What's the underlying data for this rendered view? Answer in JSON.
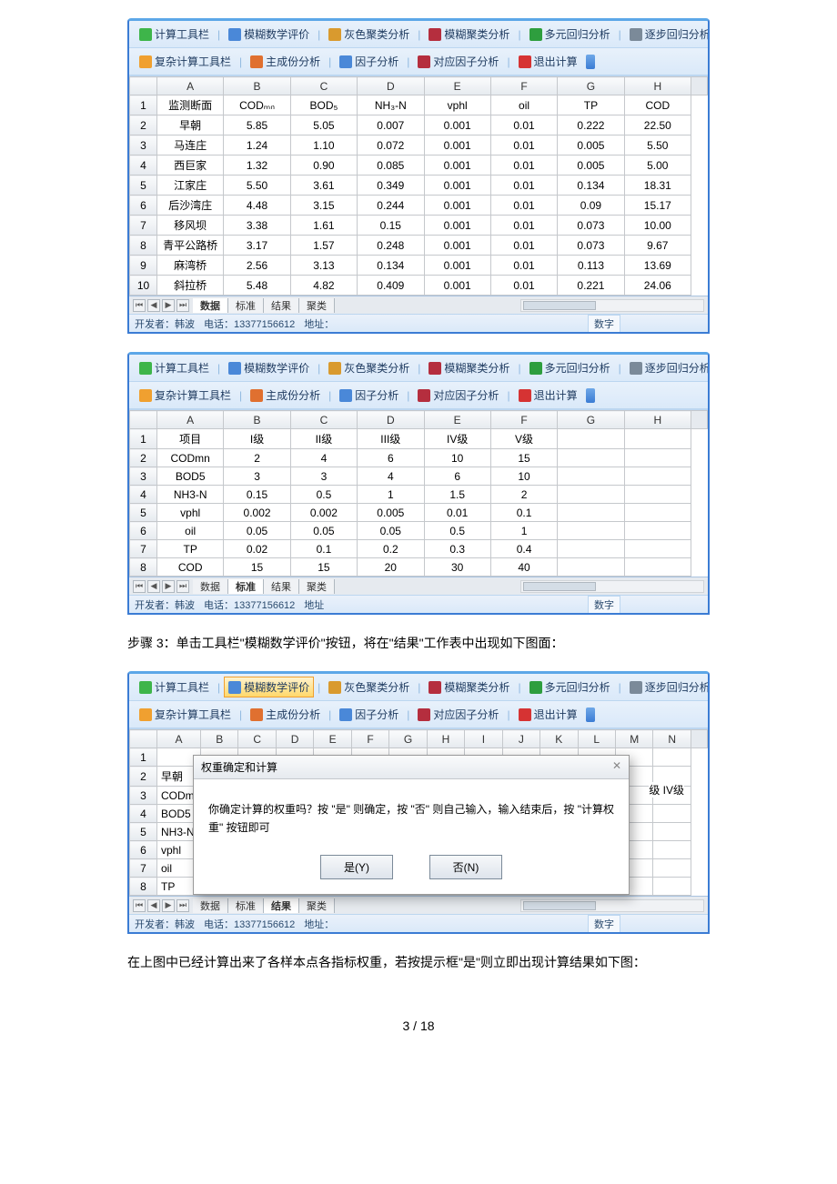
{
  "toolbar1": {
    "calc": "计算工具栏",
    "fuzzy": "模糊数学评价",
    "gray": "灰色聚类分析",
    "cluster": "模糊聚类分析",
    "regr": "多元回归分析",
    "step": "逐步回归分析"
  },
  "toolbar2": {
    "complex": "复杂计算工具栏",
    "pca": "主成份分析",
    "factor": "因子分析",
    "corr": "对应因子分析",
    "exit": "退出计算"
  },
  "cols8": [
    "A",
    "B",
    "C",
    "D",
    "E",
    "F",
    "G",
    "H"
  ],
  "cols14": [
    "A",
    "B",
    "C",
    "D",
    "E",
    "F",
    "G",
    "H",
    "I",
    "J",
    "K",
    "L",
    "M",
    "N"
  ],
  "table1": {
    "rows": [
      {
        "n": "1",
        "a": "监测断面",
        "b": "CODₘₙ",
        "c": "BOD₅",
        "d": "NH₃-N",
        "e": "vphl",
        "f": "oil",
        "g": "TP",
        "h": "COD"
      },
      {
        "n": "2",
        "a": "早朝",
        "b": "5.85",
        "c": "5.05",
        "d": "0.007",
        "e": "0.001",
        "f": "0.01",
        "g": "0.222",
        "h": "22.50"
      },
      {
        "n": "3",
        "a": "马连庄",
        "b": "1.24",
        "c": "1.10",
        "d": "0.072",
        "e": "0.001",
        "f": "0.01",
        "g": "0.005",
        "h": "5.50"
      },
      {
        "n": "4",
        "a": "西巨家",
        "b": "1.32",
        "c": "0.90",
        "d": "0.085",
        "e": "0.001",
        "f": "0.01",
        "g": "0.005",
        "h": "5.00"
      },
      {
        "n": "5",
        "a": "江家庄",
        "b": "5.50",
        "c": "3.61",
        "d": "0.349",
        "e": "0.001",
        "f": "0.01",
        "g": "0.134",
        "h": "18.31"
      },
      {
        "n": "6",
        "a": "后沙湾庄",
        "b": "4.48",
        "c": "3.15",
        "d": "0.244",
        "e": "0.001",
        "f": "0.01",
        "g": "0.09",
        "h": "15.17"
      },
      {
        "n": "7",
        "a": "移风坝",
        "b": "3.38",
        "c": "1.61",
        "d": "0.15",
        "e": "0.001",
        "f": "0.01",
        "g": "0.073",
        "h": "10.00"
      },
      {
        "n": "8",
        "a": "青平公路桥",
        "b": "3.17",
        "c": "1.57",
        "d": "0.248",
        "e": "0.001",
        "f": "0.01",
        "g": "0.073",
        "h": "9.67"
      },
      {
        "n": "9",
        "a": "麻湾桥",
        "b": "2.56",
        "c": "3.13",
        "d": "0.134",
        "e": "0.001",
        "f": "0.01",
        "g": "0.113",
        "h": "13.69"
      },
      {
        "n": "10",
        "a": "斜拉桥",
        "b": "5.48",
        "c": "4.82",
        "d": "0.409",
        "e": "0.001",
        "f": "0.01",
        "g": "0.221",
        "h": "24.06"
      }
    ]
  },
  "table2": {
    "rows": [
      {
        "n": "1",
        "a": "项目",
        "b": "I级",
        "c": "II级",
        "d": "III级",
        "e": "IV级",
        "f": "V级",
        "g": "",
        "h": ""
      },
      {
        "n": "2",
        "a": "CODmn",
        "b": "2",
        "c": "4",
        "d": "6",
        "e": "10",
        "f": "15",
        "g": "",
        "h": ""
      },
      {
        "n": "3",
        "a": "BOD5",
        "b": "3",
        "c": "3",
        "d": "4",
        "e": "6",
        "f": "10",
        "g": "",
        "h": ""
      },
      {
        "n": "4",
        "a": "NH3-N",
        "b": "0.15",
        "c": "0.5",
        "d": "1",
        "e": "1.5",
        "f": "2",
        "g": "",
        "h": ""
      },
      {
        "n": "5",
        "a": "vphl",
        "b": "0.002",
        "c": "0.002",
        "d": "0.005",
        "e": "0.01",
        "f": "0.1",
        "g": "",
        "h": ""
      },
      {
        "n": "6",
        "a": "oil",
        "b": "0.05",
        "c": "0.05",
        "d": "0.05",
        "e": "0.5",
        "f": "1",
        "g": "",
        "h": ""
      },
      {
        "n": "7",
        "a": "TP",
        "b": "0.02",
        "c": "0.1",
        "d": "0.2",
        "e": "0.3",
        "f": "0.4",
        "g": "",
        "h": ""
      },
      {
        "n": "8",
        "a": "COD",
        "b": "15",
        "c": "15",
        "d": "20",
        "e": "30",
        "f": "40",
        "g": "",
        "h": ""
      }
    ]
  },
  "table3": {
    "rows": [
      {
        "n": "1",
        "a": ""
      },
      {
        "n": "2",
        "a": "早朝"
      },
      {
        "n": "3",
        "a": "CODmn"
      },
      {
        "n": "4",
        "a": "BOD5"
      },
      {
        "n": "5",
        "a": "NH3-N"
      },
      {
        "n": "6",
        "a": "vphl"
      },
      {
        "n": "7",
        "a": "oil"
      },
      {
        "n": "8",
        "a": "TP"
      }
    ],
    "extra_right": "级 IV级"
  },
  "tabs": {
    "data": "数据",
    "std": "标准",
    "result": "结果",
    "cluster": "聚类"
  },
  "status": {
    "dev": "开发者：韩波",
    "tel": "电话：13377156612",
    "addr": "地址：",
    "addr2": "地址",
    "num": "数字"
  },
  "para1": "步骤 3：单击工具栏\"模糊数学评价\"按钮，将在\"结果\"工作表中出现如下图面：",
  "para2": "在上图中已经计算出来了各样本点各指标权重，若按提示框\"是\"则立即出现计算结果如下图：",
  "dialog": {
    "title": "权重确定和计算",
    "close": "✕",
    "body": "你确定计算的权重吗？按 \"是\" 则确定，按 \"否\" 则自己输入，输入结束后，按 \"计算权重\" 按钮即可",
    "yes": "是(Y)",
    "no": "否(N)"
  },
  "page": "3 / 18"
}
